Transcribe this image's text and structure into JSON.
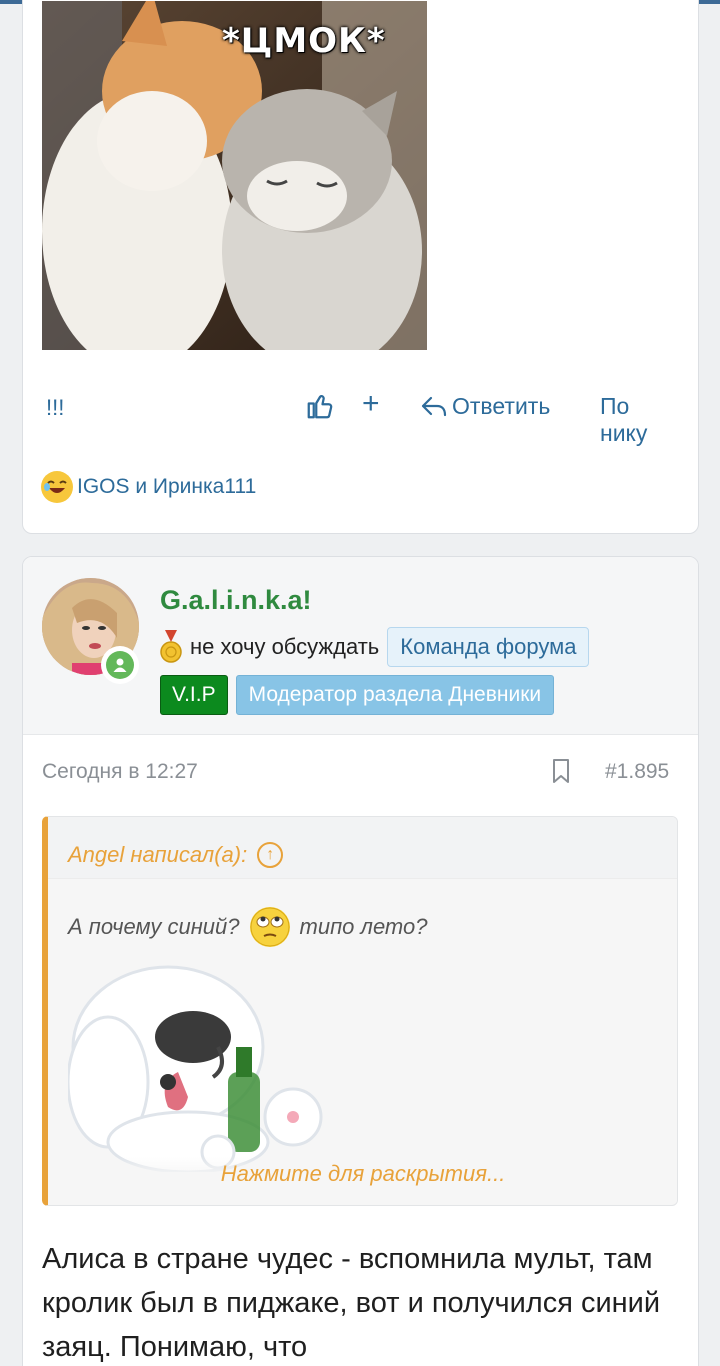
{
  "post1": {
    "image_caption": "*ЦМОК*",
    "message_tail": "!!!",
    "actions": {
      "plus_label": "+",
      "reply_label": "Ответить",
      "bynick_label": "По нику"
    },
    "reactions_text": "IGOS и Иринка111"
  },
  "post2": {
    "username": "G.a.l.i.n.k.a!",
    "user_title": "не хочу обсуждать",
    "badge_team": "Команда форума",
    "badge_vip": "V.I.P",
    "badge_moderator": "Модератор раздела Дневники",
    "date": "Сегодня в 12:27",
    "post_number": "#1.895",
    "quote": {
      "author": "Angel написал(а):",
      "text_before": "А почему синий?",
      "text_after": "типо лето?",
      "expand_label": "Нажмите для раскрытия..."
    },
    "body": "Алиса в стране чудес - вспомнила мульт, там кролик был в пиджаке, вот и получился синий заяц. Понимаю, что"
  },
  "colors": {
    "link": "#2d6b9a",
    "username": "#2f8a3f",
    "quote_accent": "#e8a23a",
    "vip": "#0c8a1e",
    "moderator": "#88c4e6"
  }
}
